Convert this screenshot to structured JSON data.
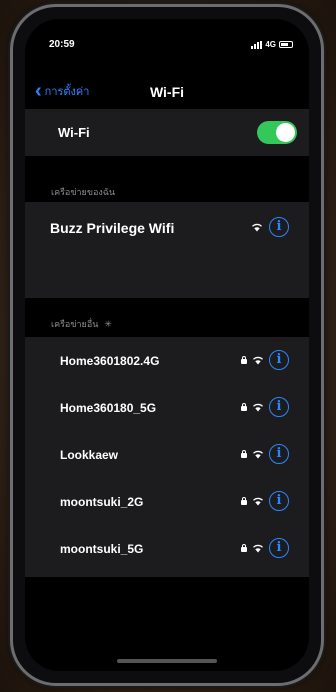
{
  "status_bar": {
    "time": "20:59",
    "network": "4G"
  },
  "nav": {
    "back_label": "การตั้งค่า",
    "title": "Wi-Fi"
  },
  "wifi": {
    "label": "Wi-Fi",
    "enabled": true
  },
  "current_section": {
    "header": "เครือข่ายของฉัน",
    "network": "Buzz Privilege Wifi"
  },
  "networks_section": {
    "header": "เครือข่ายอื่น",
    "items": [
      {
        "name": "Home3601802.4G",
        "locked": true
      },
      {
        "name": "Home360180_5G",
        "locked": true
      },
      {
        "name": "Lookkaew",
        "locked": true
      },
      {
        "name": "moontsuki_2G",
        "locked": true
      },
      {
        "name": "moontsuki_5G",
        "locked": true
      }
    ]
  },
  "colors": {
    "accent": "#2c86ff",
    "toggle_on": "#34c759",
    "row_bg": "#1c1c1e"
  },
  "icons": {
    "back": "chevron-left-icon",
    "wifi": "wifi-icon",
    "lock": "lock-icon",
    "info": "info-icon",
    "spinner": "spinner-icon"
  }
}
